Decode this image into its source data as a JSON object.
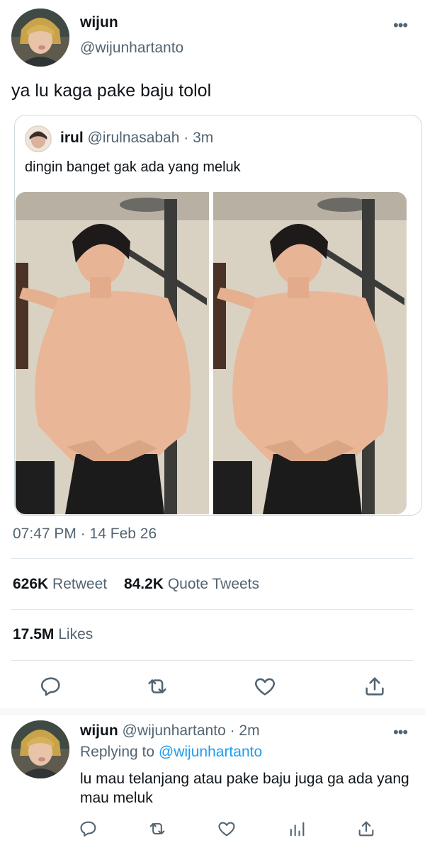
{
  "tweet": {
    "author_name": "wijun",
    "author_handle": "@wijunhartanto",
    "text": "ya lu kaga pake baju tolol",
    "timestamp": "07:47 PM · 14 Feb 26",
    "more_icon": "more-horizontal-icon"
  },
  "quote": {
    "author_name": "irul",
    "author_handle": "@irulnasabah",
    "time": "· 3m",
    "text": "dingin banget gak ada yang meluk",
    "photos": [
      "photo-1",
      "photo-2"
    ]
  },
  "stats": {
    "retweets_count": "626K",
    "retweets_label": "Retweet",
    "quotes_count": "84.2K",
    "quotes_label": "Quote Tweets",
    "likes_count": "17.5M",
    "likes_label": "Likes"
  },
  "actions": {
    "icons": [
      "reply-icon",
      "retweet-icon",
      "like-icon",
      "share-icon"
    ]
  },
  "reply": {
    "author_name": "wijun",
    "author_handle": "@wijunhartanto",
    "time": "· 2m",
    "replying_prefix": "Replying to",
    "replying_to": "@wijunhartanto",
    "text": "lu mau telanjang atau pake baju juga ga ada yang mau meluk",
    "icons": [
      "reply-icon",
      "retweet-icon",
      "like-icon",
      "analytics-icon",
      "share-icon"
    ]
  },
  "colors": {
    "link": "#1d9bf0",
    "secondary_text": "#536471",
    "divider": "#e1e8ed"
  }
}
